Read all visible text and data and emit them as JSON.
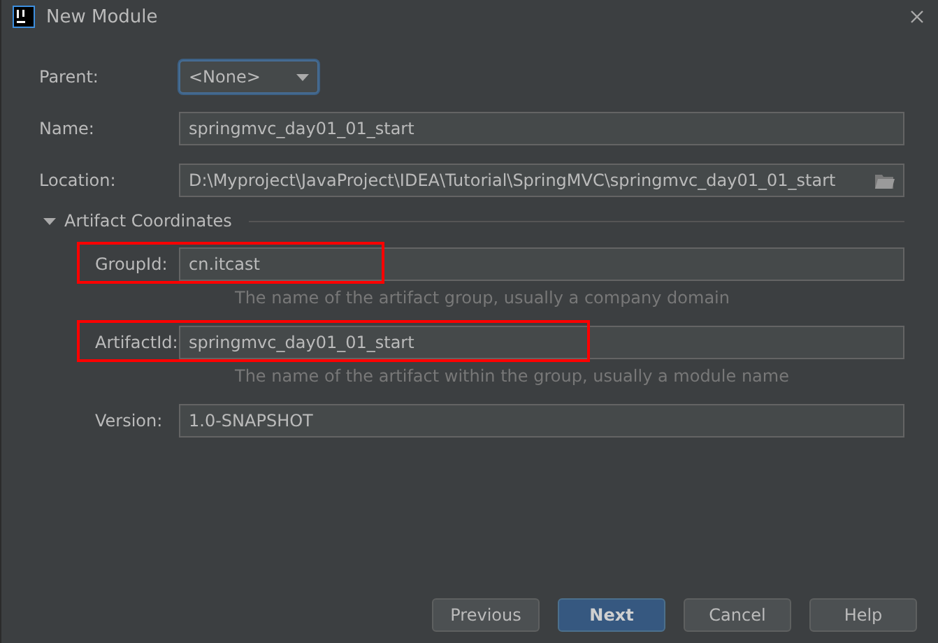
{
  "window": {
    "title": "New Module"
  },
  "fields": [
    {
      "label": "Parent:",
      "kind": "dropdown",
      "value": "<None>",
      "focused": true
    },
    {
      "label": "Name:",
      "kind": "text",
      "value": "springmvc_day01_01_start",
      "focused": false
    },
    {
      "label": "Location:",
      "kind": "path",
      "value": "D:\\Myproject\\JavaProject\\IDEA\\Tutorial\\SpringMVC\\springmvc_day01_01_start",
      "focused": false
    }
  ],
  "section": {
    "title": "Artifact Coordinates",
    "expanded": true,
    "fields": [
      {
        "label": "GroupId:",
        "value": "cn.itcast",
        "hint": "The name of the artifact group, usually a company domain",
        "highlighted": true
      },
      {
        "label": "ArtifactId:",
        "value": "springmvc_day01_01_start",
        "hint": "The name of the artifact within the group, usually a module name",
        "highlighted": true
      },
      {
        "label": "Version:",
        "value": "1.0-SNAPSHOT",
        "highlighted": false
      }
    ]
  },
  "buttons": [
    {
      "label": "Previous",
      "default": false
    },
    {
      "label": "Next",
      "default": true
    },
    {
      "label": "Cancel",
      "default": false
    },
    {
      "label": "Help",
      "default": false
    }
  ]
}
